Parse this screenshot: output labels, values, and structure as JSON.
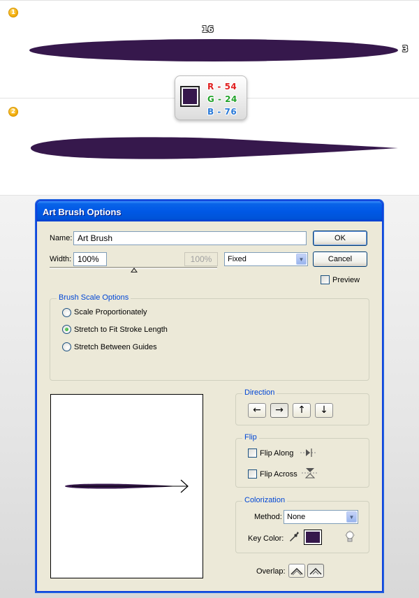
{
  "illustration": {
    "step1_badge": "1",
    "step2_badge": "2",
    "width_label": "16",
    "height_label": "3",
    "shape_color": "#36184c",
    "swatch": {
      "color": "#36184c",
      "r": "R - 54",
      "g": "G - 24",
      "b": "B - 76",
      "r_color": "#e02020",
      "g_color": "#22a22a",
      "b_color": "#2a7ad8"
    }
  },
  "dialog": {
    "title": "Art Brush Options",
    "name_label": "Name:",
    "name_value": "Art Brush",
    "width_label": "Width:",
    "width_value": "100%",
    "width_max_value": "100%",
    "width_mode": "Fixed",
    "ok_label": "OK",
    "cancel_label": "Cancel",
    "preview_label": "Preview",
    "preview_checked": false,
    "brush_scale": {
      "title": "Brush Scale Options",
      "options": [
        "Scale Proportionately",
        "Stretch to Fit Stroke Length",
        "Stretch Between Guides"
      ],
      "selected": "Stretch to Fit Stroke Length"
    },
    "direction": {
      "title": "Direction",
      "buttons": [
        "left-arrow",
        "right-arrow",
        "up-arrow",
        "down-arrow"
      ],
      "selected": "right-arrow"
    },
    "flip": {
      "title": "Flip",
      "flip_along_label": "Flip Along",
      "flip_across_label": "Flip Across"
    },
    "colorization": {
      "title": "Colorization",
      "method_label": "Method:",
      "method_value": "None",
      "key_color_label": "Key Color:",
      "key_color": "#36184c"
    },
    "overlap_label": "Overlap:"
  }
}
